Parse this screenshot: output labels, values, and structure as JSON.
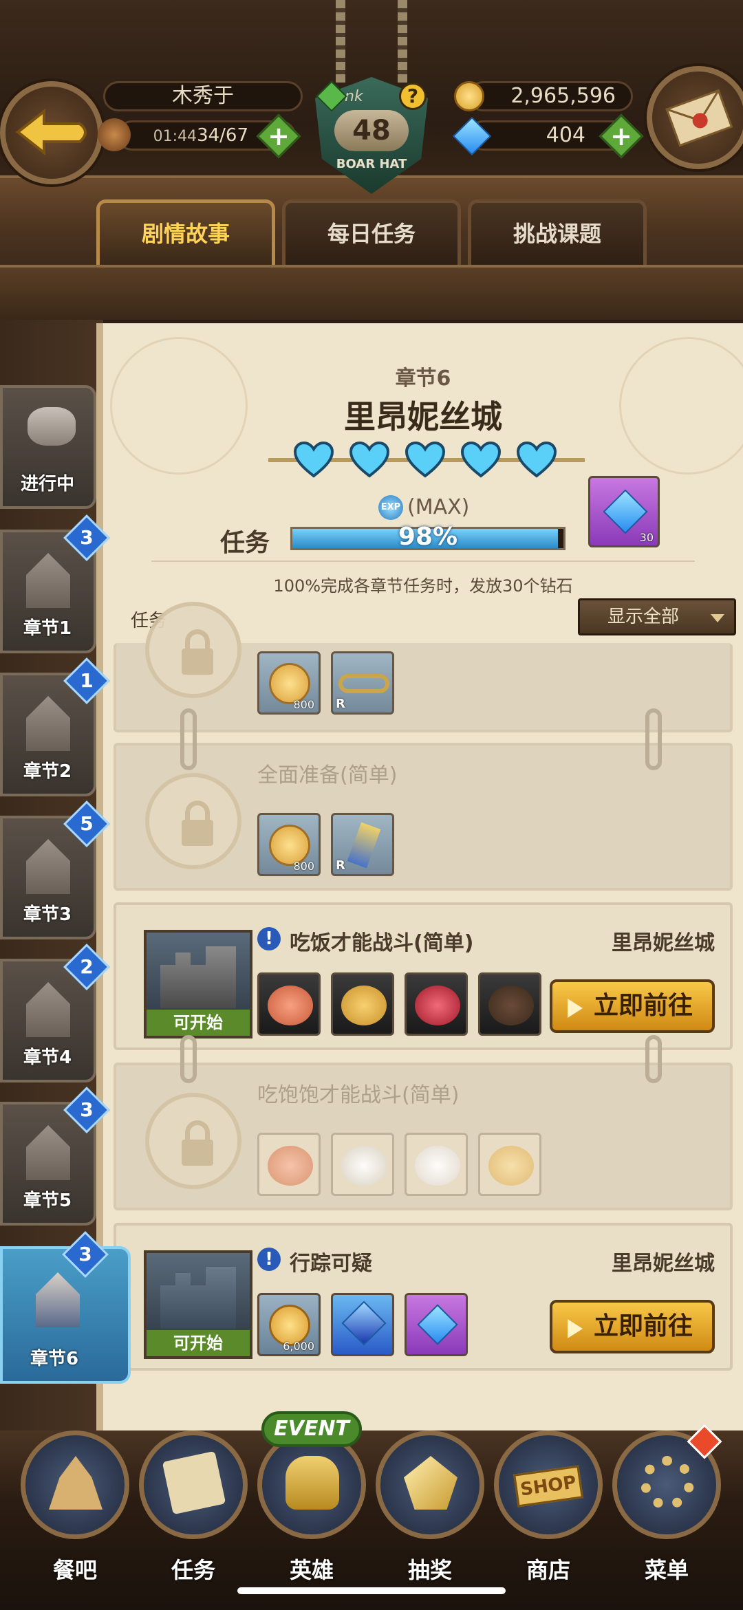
{
  "header": {
    "player_name": "木秀于",
    "stamina_timer": "01:44",
    "stamina": "34/67",
    "gold": "2,965,596",
    "diamonds": "404",
    "rank_label": "Rank",
    "rank_level": "48",
    "rank_guild": "BOAR HAT"
  },
  "tabs": [
    {
      "label": "剧情故事",
      "active": true
    },
    {
      "label": "每日任务",
      "active": false
    },
    {
      "label": "挑战课题",
      "active": false
    }
  ],
  "chapter": {
    "number_label": "章节6",
    "title": "里昂妮丝城",
    "hearts": 5,
    "exp_label": "(MAX)",
    "progress_label": "任务",
    "progress_percent": 98,
    "progress_text": "98%",
    "reward_count": "30",
    "note": "100%完成各章节任务时，发放30个钻石"
  },
  "filter": {
    "section_label": "任务",
    "dropdown_value": "显示全部"
  },
  "sidebar": [
    {
      "label": "进行中",
      "badge": ""
    },
    {
      "label": "章节1",
      "badge": "3"
    },
    {
      "label": "章节2",
      "badge": "1"
    },
    {
      "label": "章节3",
      "badge": "5"
    },
    {
      "label": "章节4",
      "badge": "2"
    },
    {
      "label": "章节5",
      "badge": "3"
    },
    {
      "label": "章节6",
      "badge": "3"
    }
  ],
  "quests": [
    {
      "title": "",
      "locked": true,
      "rewards": [
        {
          "type": "gold",
          "count": "800"
        },
        {
          "type": "belt",
          "rank": "R"
        }
      ]
    },
    {
      "title": "全面准备(简单)",
      "locked": true,
      "rewards": [
        {
          "type": "gold",
          "count": "800"
        },
        {
          "type": "amulet",
          "rank": "R"
        }
      ]
    },
    {
      "title": "吃饭才能战斗(简单)",
      "locked": false,
      "location": "里昂妮丝城",
      "status": "可开始",
      "button": "立即前往",
      "rewards": [
        {
          "type": "salmon"
        },
        {
          "type": "potato"
        },
        {
          "type": "berries"
        },
        {
          "type": "stew"
        }
      ]
    },
    {
      "title": "吃饱饱才能战斗(简单)",
      "locked": true,
      "rewards": [
        {
          "type": "salmon"
        },
        {
          "type": "buns"
        },
        {
          "type": "rice"
        },
        {
          "type": "pancake"
        }
      ]
    },
    {
      "title": "行踪可疑",
      "locked": false,
      "location": "里昂妮丝城",
      "status": "可开始",
      "button": "立即前往",
      "rewards": [
        {
          "type": "gold",
          "count": "6,000"
        },
        {
          "type": "blue-crystal"
        },
        {
          "type": "diamond"
        }
      ]
    }
  ],
  "bottom_nav": [
    {
      "label": "餐吧"
    },
    {
      "label": "任务"
    },
    {
      "label": "英雄",
      "tag": "EVENT"
    },
    {
      "label": "抽奖"
    },
    {
      "label": "商店",
      "sign": "SHOP"
    },
    {
      "label": "菜单"
    }
  ],
  "colors": {
    "accent_gold": "#ffd35a",
    "progress_blue": "#3aa8e0",
    "go_button": "#f0b430",
    "badge_blue": "#2a6ad0"
  }
}
